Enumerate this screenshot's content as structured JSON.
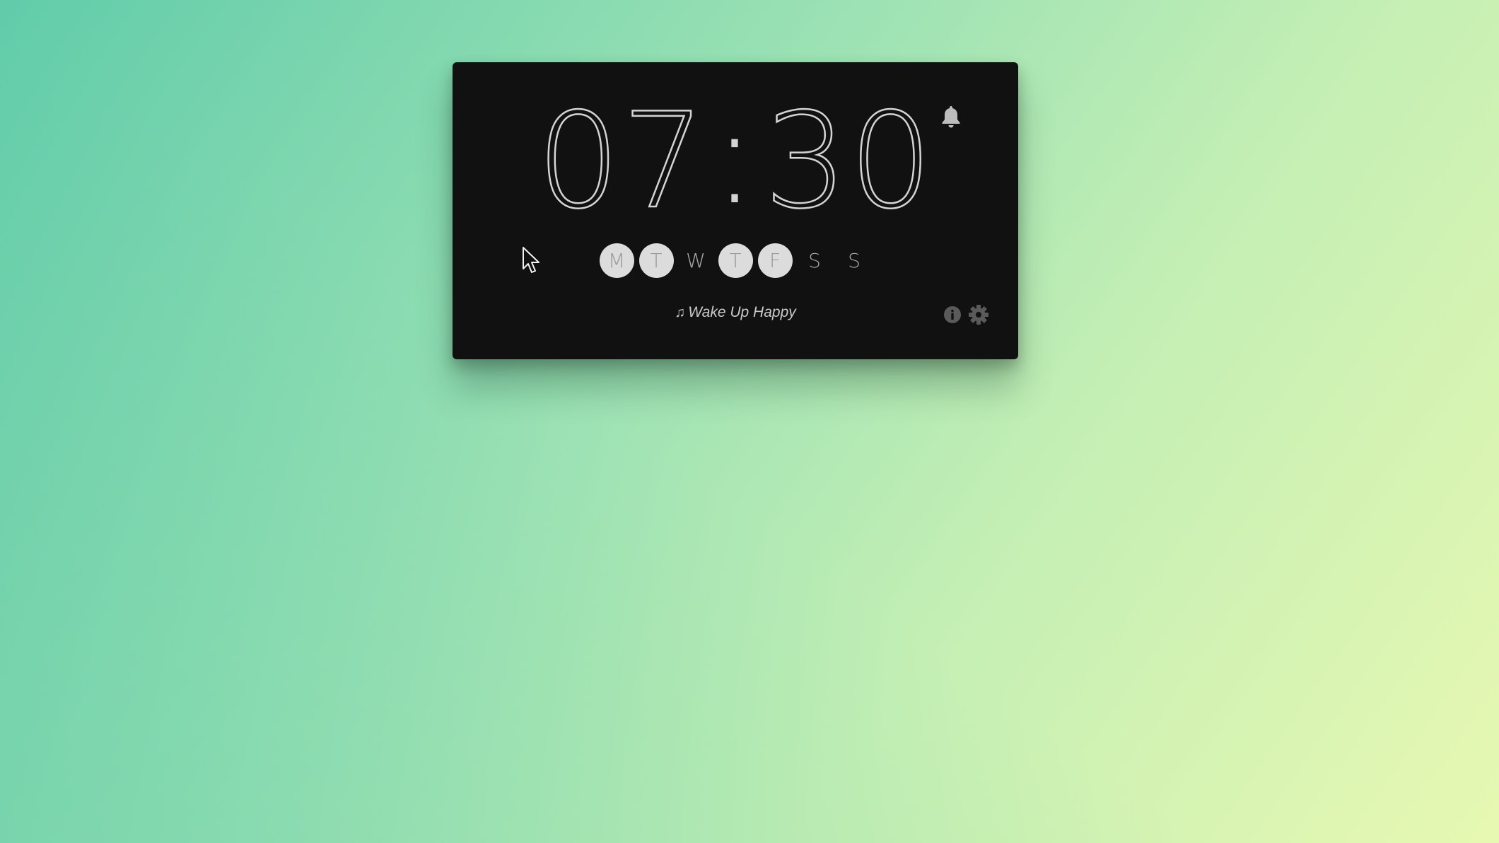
{
  "alarm": {
    "hours": "07",
    "separator": ":",
    "minutes": "30",
    "days": [
      {
        "label": "M",
        "active": true
      },
      {
        "label": "T",
        "active": true
      },
      {
        "label": "W",
        "active": false
      },
      {
        "label": "T",
        "active": true
      },
      {
        "label": "F",
        "active": true
      },
      {
        "label": "S",
        "active": false
      },
      {
        "label": "S",
        "active": false
      }
    ],
    "song": "Wake Up Happy",
    "note_glyph": "♫"
  },
  "icons": {
    "bell": "bell-icon",
    "info": "info-icon",
    "settings": "gear-icon",
    "music": "music-note-icon",
    "cursor": "mouse-cursor-icon"
  },
  "colors": {
    "card": "#111111",
    "digits": "#d4d4d4",
    "day_active_bg": "#dcdcdc",
    "day_text": "#a9a9a9",
    "icon": "#5a5a5a",
    "bell": "#bdbdbd"
  }
}
